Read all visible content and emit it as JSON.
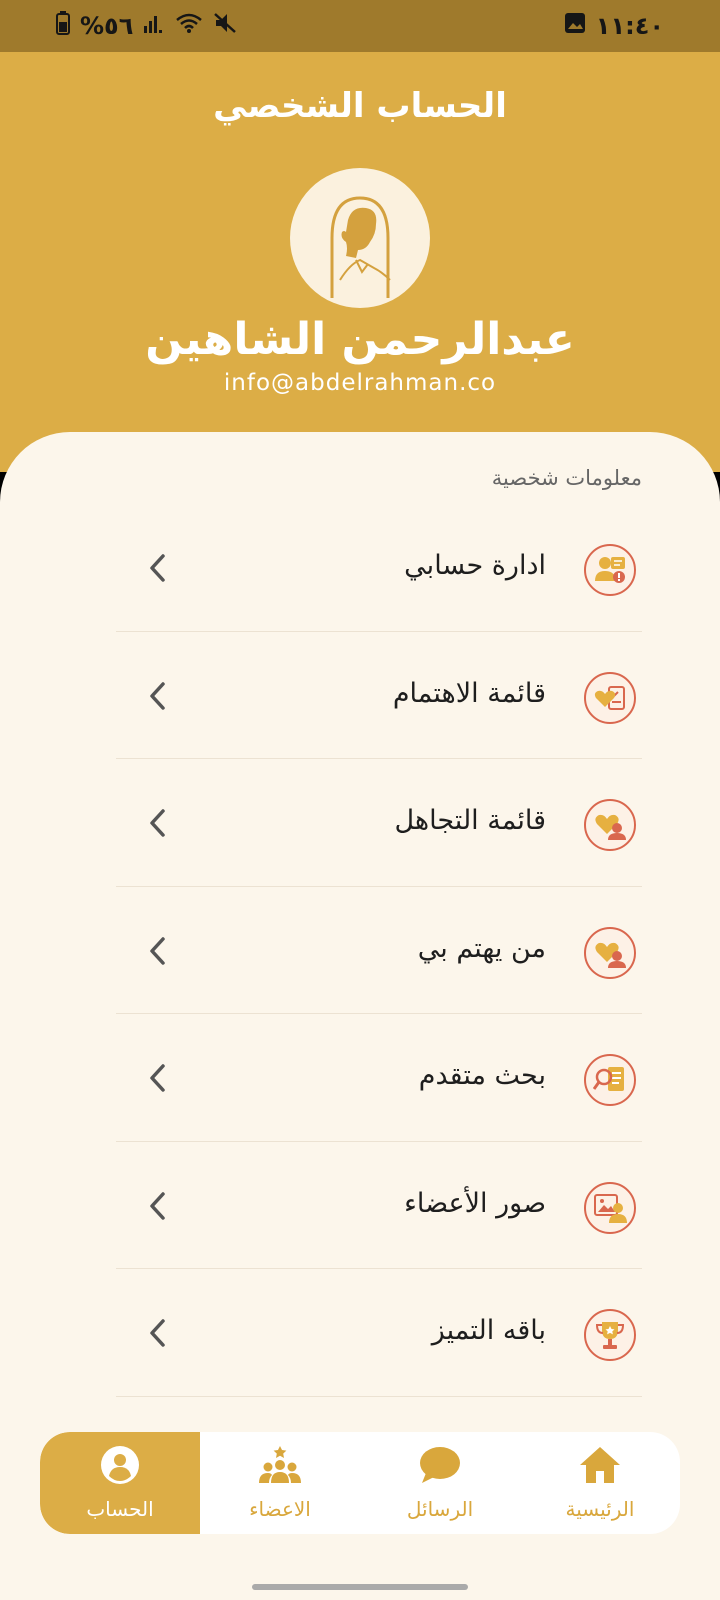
{
  "status_bar": {
    "battery": "%٥٦",
    "time": "١١:٤٠",
    "icons": [
      "battery-icon",
      "signal-icon",
      "wifi-icon",
      "mute-icon",
      "gallery-icon"
    ]
  },
  "header": {
    "title": "الحساب الشخصي",
    "name": "عبدالرحمن الشاهين",
    "email": "info@abdelrahman.co"
  },
  "section_label": "معلومات شخصية",
  "menu": [
    {
      "label": "ادارة حسابي",
      "icon": "user-alert-icon"
    },
    {
      "label": "قائمة الاهتمام",
      "icon": "heart-list-icon"
    },
    {
      "label": "قائمة التجاهل",
      "icon": "heart-user-icon"
    },
    {
      "label": "من يهتم بي",
      "icon": "heart-user-icon"
    },
    {
      "label": "بحث متقدم",
      "icon": "search-document-icon"
    },
    {
      "label": "صور الأعضاء",
      "icon": "image-user-icon"
    },
    {
      "label": "باقه التميز",
      "icon": "trophy-icon"
    }
  ],
  "bottom_nav": [
    {
      "label": "الحساب",
      "icon": "account-icon",
      "active": true
    },
    {
      "label": "الاعضاء",
      "icon": "members-icon",
      "active": false
    },
    {
      "label": "الرسائل",
      "icon": "chat-icon",
      "active": false
    },
    {
      "label": "الرئيسية",
      "icon": "home-icon",
      "active": false
    }
  ],
  "colors": {
    "primary": "#dcad46",
    "status_bar": "#9f7a2c",
    "background": "#fcf6eb",
    "icon_accent": "#d9674e",
    "icon_fill": "#e6b040"
  }
}
